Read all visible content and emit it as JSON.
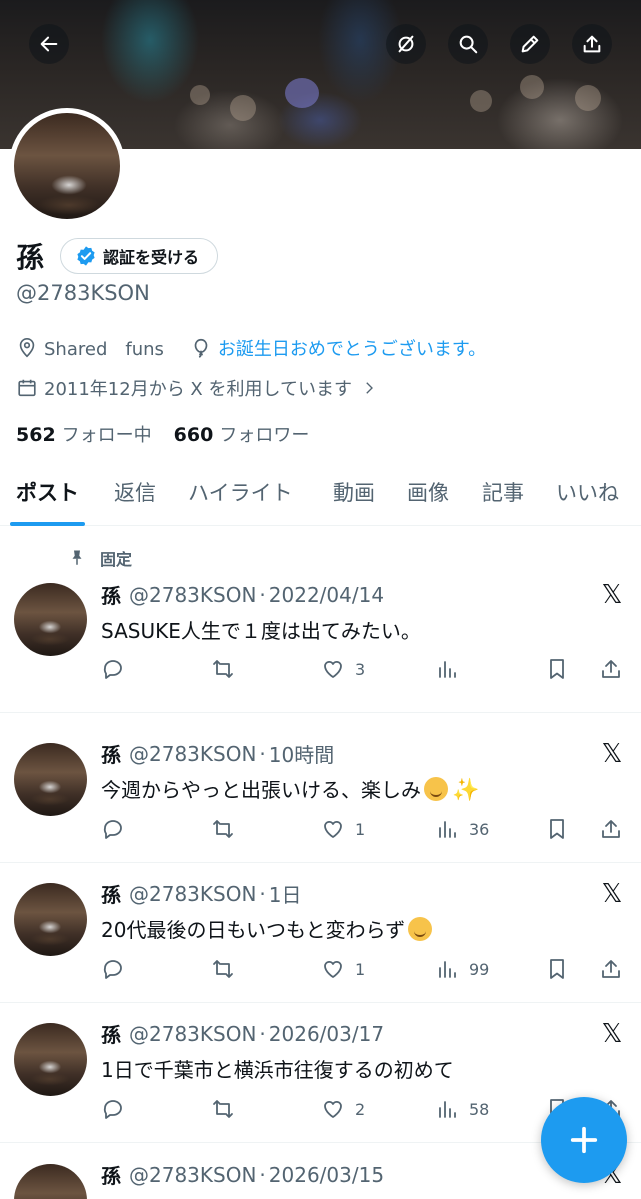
{
  "profile": {
    "name": "孫",
    "verify_label": "認証を受ける",
    "handle": "@2783KSON",
    "location": "Shared　funs",
    "birthday_text": "お誕生日おめでとうございます。",
    "joined": "2011年12月から X を利用しています",
    "following_count": "562",
    "following_label": "フォロー中",
    "followers_count": "660",
    "followers_label": "フォロワー"
  },
  "tabs": [
    "ポスト",
    "返信",
    "ハイライト",
    "動画",
    "画像",
    "記事",
    "いいね"
  ],
  "pinned_label": "固定",
  "posts": [
    {
      "name": "孫",
      "handle": "@2783KSON",
      "time": "2022/04/14",
      "text": "SASUKE人生で１度は出てみたい。",
      "likes": "3",
      "views": ""
    },
    {
      "name": "孫",
      "handle": "@2783KSON",
      "time": "10時間",
      "text": "今週からやっと出張いける、楽しみ",
      "likes": "1",
      "views": "36"
    },
    {
      "name": "孫",
      "handle": "@2783KSON",
      "time": "1日",
      "text": "20代最後の日もいつもと変わらず",
      "likes": "1",
      "views": "99"
    },
    {
      "name": "孫",
      "handle": "@2783KSON",
      "time": "2026/03/17",
      "text": "1日で千葉市と横浜市往復するの初めて",
      "likes": "2",
      "views": "58"
    },
    {
      "name": "孫",
      "handle": "@2783KSON",
      "time": "2026/03/15",
      "text": "",
      "likes": "",
      "views": ""
    }
  ],
  "separator": "·",
  "colors": {
    "accent": "#1d9bf0",
    "text": "#0f1419",
    "secondary": "#536471",
    "border": "#eff3f4"
  }
}
